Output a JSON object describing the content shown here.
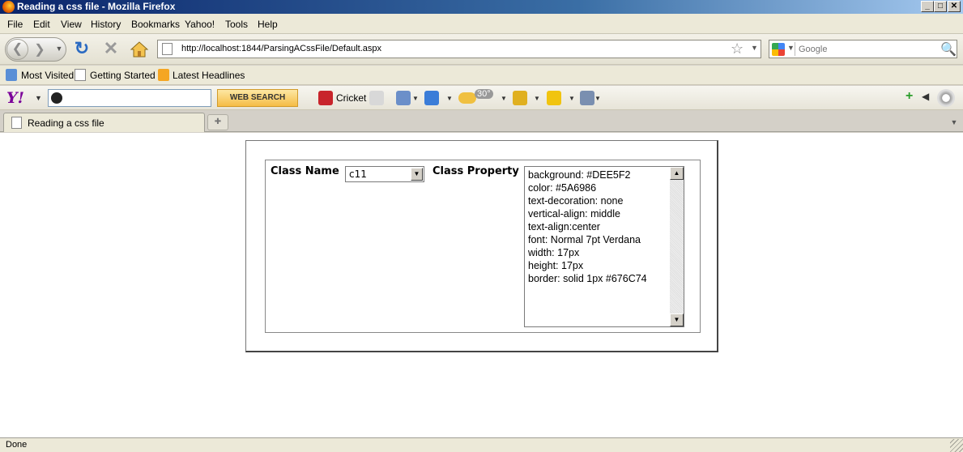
{
  "window": {
    "title": "Reading a css file - Mozilla Firefox",
    "minimize": "_",
    "maximize": "□",
    "close": "✕"
  },
  "menu": {
    "items": [
      "File",
      "Edit",
      "View",
      "History",
      "Bookmarks",
      "Yahoo!",
      "Tools",
      "Help"
    ]
  },
  "nav": {
    "url": "http://localhost:1844/ParsingACssFile/Default.aspx",
    "search_placeholder": "Google"
  },
  "bookmarks": {
    "items": [
      "Most Visited",
      "Getting Started",
      "Latest Headlines"
    ]
  },
  "yahoo_toolbar": {
    "logo": "Y!",
    "web_search_label": "WEB SEARCH",
    "cricket_label": "Cricket",
    "weather_temp": "30°"
  },
  "tabs": {
    "active_tab_title": "Reading a css file"
  },
  "form": {
    "class_name_label": "Class Name",
    "class_name_value": "c11",
    "class_property_label": "Class Property",
    "class_property_lines": [
      "background: #DEE5F2",
      "color: #5A6986",
      "text-decoration: none",
      "vertical-align: middle",
      "text-align:center",
      "font: Normal 7pt Verdana",
      "width: 17px",
      "height: 17px",
      "border: solid 1px #676C74"
    ]
  },
  "status": {
    "text": "Done"
  },
  "colors": {
    "titlebar_start": "#0a246a",
    "titlebar_end": "#a6caf0",
    "chrome_bg": "#ece9d8",
    "content_bg": "#ffffff",
    "web_search_btn": "#f5bd45"
  }
}
